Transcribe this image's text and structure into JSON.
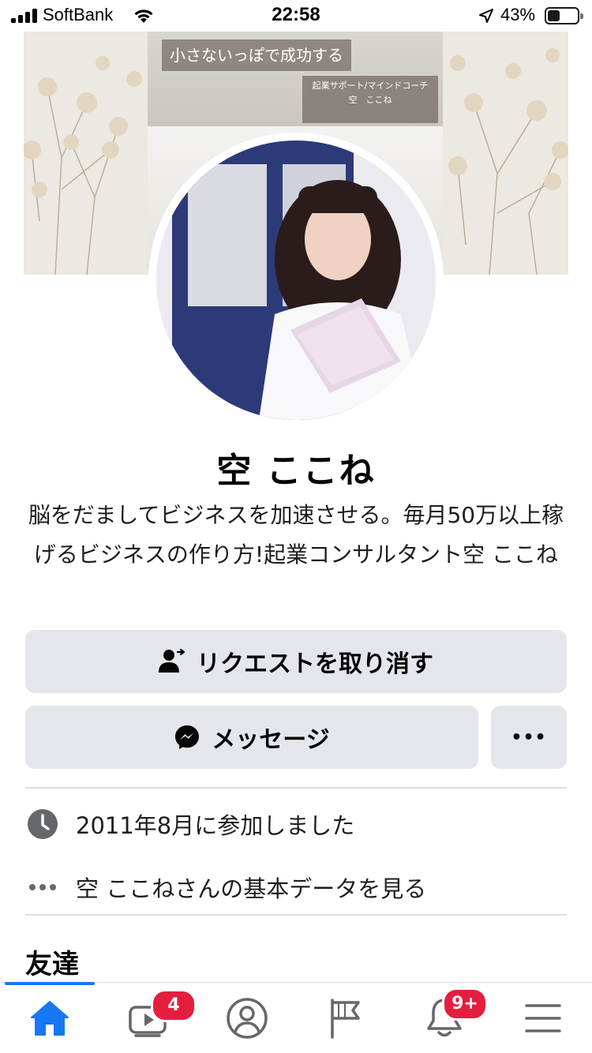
{
  "status_bar": {
    "carrier": "SoftBank",
    "time": "22:58",
    "battery_percent": "43%",
    "battery_level": 0.43
  },
  "cover": {
    "caption": "小さないっぽで成功する",
    "subtitle_line1": "起業サポート/マインドコーチ",
    "subtitle_line2": "空　ここね"
  },
  "profile": {
    "name": "空 ここね",
    "bio": "脳をだましてビジネスを加速させる。毎月50万以上稼げるビジネスの作り方!起業コンサルタント空 ここね"
  },
  "actions": {
    "request_label": "リクエストを取り消す",
    "message_label": "メッセージ",
    "more_label": "•••"
  },
  "info": {
    "joined": "2011年8月に参加しました",
    "more_info": "空 ここねさんの基本データを見る"
  },
  "sections": {
    "friends_title": "友達"
  },
  "nav": {
    "video_badge": "4",
    "notifications_badge": "9+"
  },
  "colors": {
    "accent": "#1877f2",
    "badge": "#e41e3f",
    "button_bg": "#e4e6eb"
  }
}
